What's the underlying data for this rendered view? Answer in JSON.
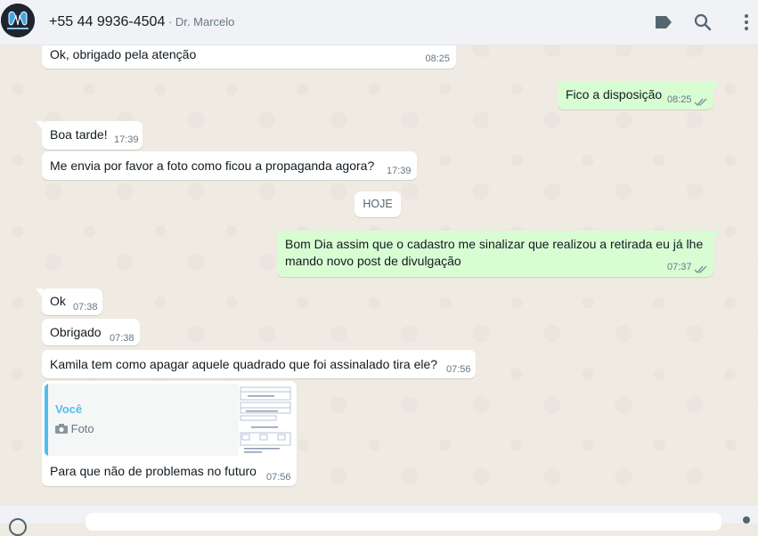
{
  "header": {
    "phone": "+55 44 9936-4504",
    "separator": " · ",
    "name": "Dr. Marcelo",
    "icons": [
      "label-icon",
      "search-icon",
      "menu-icon"
    ]
  },
  "messages": [
    {
      "text": "Ok, obrigado pela atenção",
      "time": "08:25",
      "dir": "in"
    },
    {
      "text": "Fico a disposição",
      "time": "08:25",
      "dir": "out",
      "status": "read"
    },
    {
      "text": "Boa tarde!",
      "time": "17:39",
      "dir": "in"
    },
    {
      "text": "Me envia por favor a foto como ficou a propaganda agora?",
      "time": "17:39",
      "dir": "in"
    },
    {
      "line1": "Bom Dia assim que o cadastro me sinalizar que realizou a retirada eu já lhe",
      "line2": "mando novo post  de divulgação",
      "time": "07:37",
      "dir": "out",
      "status": "read"
    },
    {
      "text": "Ok",
      "time": "07:38",
      "dir": "in"
    },
    {
      "text": "Obrigado",
      "time": "07:38",
      "dir": "in"
    },
    {
      "text": "Kamila tem como apagar aquele quadrado que foi assinalado tira ele?",
      "time": "07:56",
      "dir": "in"
    },
    {
      "text": "Para que não de problemas no futuro",
      "time": "07:56",
      "dir": "in",
      "quote": {
        "author": "Você",
        "kind": "Foto",
        "icon": "camera-icon"
      }
    }
  ],
  "day_separator": "HOJE",
  "colors": {
    "incoming": "#ffffff",
    "outgoing": "#d9fdd3",
    "quote_accent": "#53bdeb",
    "background": "#efeae2"
  }
}
